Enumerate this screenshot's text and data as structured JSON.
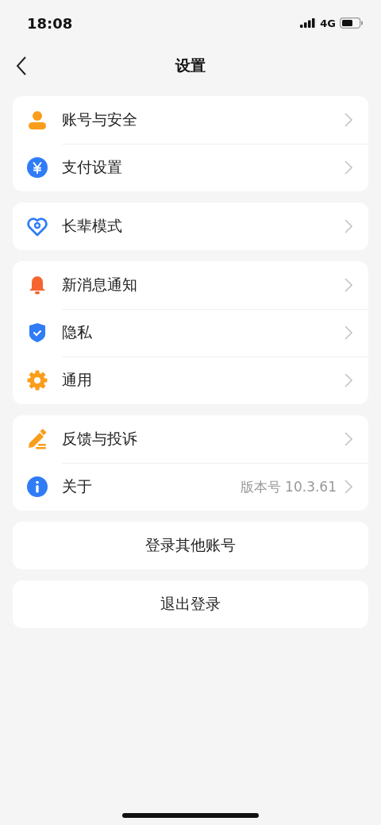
{
  "status_bar": {
    "time": "18:08",
    "network": "4G"
  },
  "nav": {
    "title": "设置"
  },
  "groups": [
    {
      "items": [
        {
          "kind": "person",
          "label": "账号与安全"
        },
        {
          "kind": "yuan",
          "label": "支付设置"
        }
      ]
    },
    {
      "items": [
        {
          "kind": "heart",
          "label": "长辈模式"
        }
      ]
    },
    {
      "items": [
        {
          "kind": "bell",
          "label": "新消息通知"
        },
        {
          "kind": "shield",
          "label": "隐私"
        },
        {
          "kind": "gear",
          "label": "通用"
        }
      ]
    },
    {
      "items": [
        {
          "kind": "pencil",
          "label": "反馈与投诉"
        },
        {
          "kind": "info",
          "label": "关于",
          "value": "版本号 10.3.61"
        }
      ]
    }
  ],
  "buttons": [
    "登录其他账号",
    "退出登录"
  ]
}
